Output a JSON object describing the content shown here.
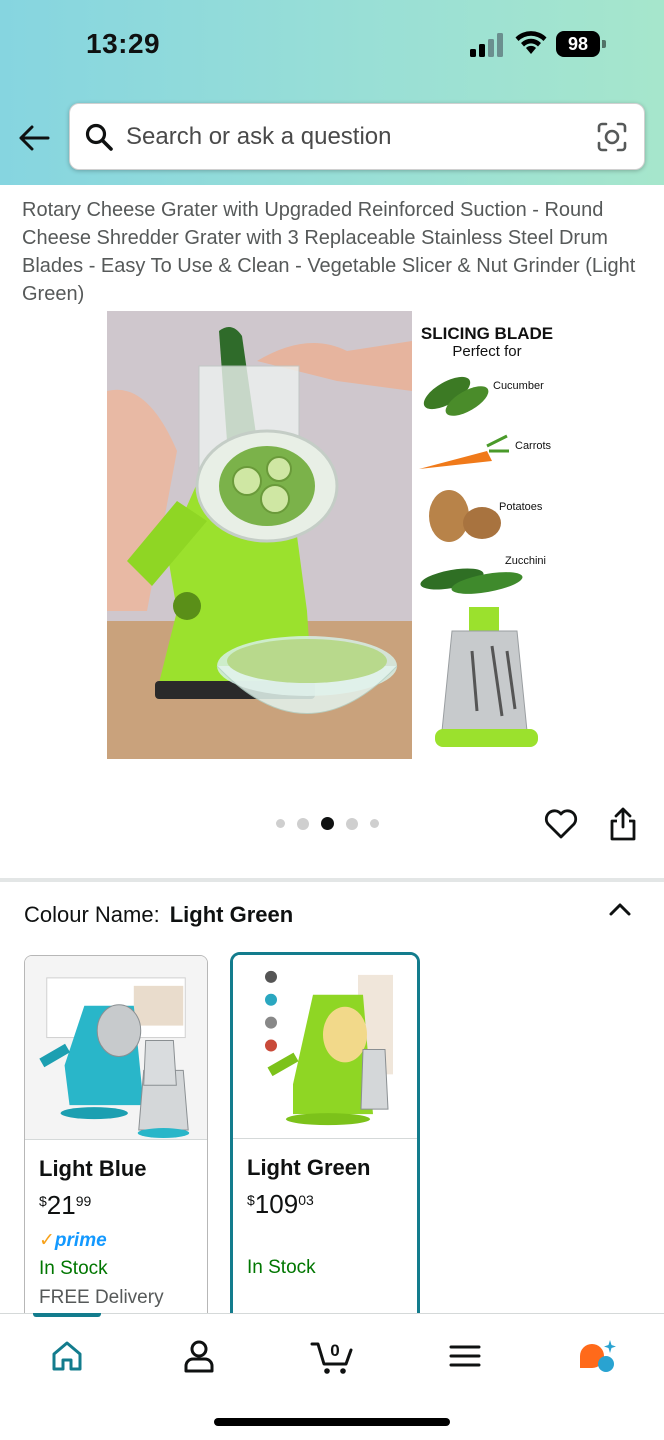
{
  "status_bar": {
    "time": "13:29",
    "battery": "98"
  },
  "search": {
    "placeholder": "Search or ask a question"
  },
  "product": {
    "title": "Rotary Cheese Grater with Upgraded Reinforced Suction - Round Cheese Shredder Grater with 3 Replaceable Stainless Steel Drum Blades - Easy To Use & Clean - Vegetable Slicer & Nut Grinder (Light Green)",
    "image_text": {
      "heading": "SLICING BLADE",
      "subheading": "Perfect for",
      "items": [
        "Cucumber",
        "Carrots",
        "Potatoes",
        "Zucchini"
      ]
    },
    "image_count": 5,
    "active_image": 3
  },
  "colour": {
    "label": "Colour Name:",
    "selected": "Light Green",
    "options": [
      {
        "name": "Light Blue",
        "price_symbol": "$",
        "price_whole": "21",
        "price_cents": "99",
        "prime": "prime",
        "stock": "In Stock",
        "delivery": "FREE Delivery"
      },
      {
        "name": "Light Green",
        "price_symbol": "$",
        "price_whole": "109",
        "price_cents": "03",
        "stock": "In Stock"
      }
    ]
  },
  "tabbar": {
    "items": [
      "home-icon",
      "account-icon",
      "cart-icon",
      "menu-icon",
      "assistant-icon"
    ],
    "cart_count": "0"
  },
  "colors": {
    "accent": "#137c8d",
    "in_stock": "#007600",
    "prime": "#1399ff",
    "header_gradient_start": "#86d5e0",
    "header_gradient_end": "#a6e6cc"
  }
}
